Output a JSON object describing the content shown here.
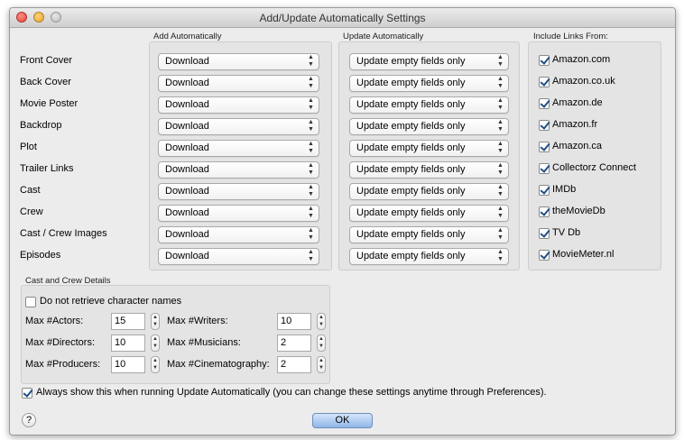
{
  "window": {
    "title": "Add/Update Automatically Settings"
  },
  "columns": {
    "add": "Add Automatically",
    "update": "Update Automatically",
    "links": "Include Links From:"
  },
  "rows": [
    {
      "label": "Front Cover",
      "add": "Download",
      "update": "Update empty fields only"
    },
    {
      "label": "Back Cover",
      "add": "Download",
      "update": "Update empty fields only"
    },
    {
      "label": "Movie Poster",
      "add": "Download",
      "update": "Update empty fields only"
    },
    {
      "label": "Backdrop",
      "add": "Download",
      "update": "Update empty fields only"
    },
    {
      "label": "Plot",
      "add": "Download",
      "update": "Update empty fields only"
    },
    {
      "label": "Trailer Links",
      "add": "Download",
      "update": "Update empty fields only"
    },
    {
      "label": "Cast",
      "add": "Download",
      "update": "Update empty fields only"
    },
    {
      "label": "Crew",
      "add": "Download",
      "update": "Update empty fields only"
    },
    {
      "label": "Cast / Crew Images",
      "add": "Download",
      "update": "Update empty fields only"
    },
    {
      "label": "Episodes",
      "add": "Download",
      "update": "Update empty fields only"
    }
  ],
  "links": [
    {
      "label": "Amazon.com",
      "checked": true
    },
    {
      "label": "Amazon.co.uk",
      "checked": true
    },
    {
      "label": "Amazon.de",
      "checked": true
    },
    {
      "label": "Amazon.fr",
      "checked": true
    },
    {
      "label": "Amazon.ca",
      "checked": true
    },
    {
      "label": "Collectorz Connect",
      "checked": true
    },
    {
      "label": "IMDb",
      "checked": true
    },
    {
      "label": "theMovieDb",
      "checked": true
    },
    {
      "label": "TV Db",
      "checked": true
    },
    {
      "label": "MovieMeter.nl",
      "checked": true
    }
  ],
  "cast_crew": {
    "title": "Cast and Crew Details",
    "no_char_names": {
      "label": "Do not retrieve character names",
      "checked": false
    },
    "fields": {
      "actors": {
        "label": "Max #Actors:",
        "value": "15"
      },
      "directors": {
        "label": "Max #Directors:",
        "value": "10"
      },
      "producers": {
        "label": "Max #Producers:",
        "value": "10"
      },
      "writers": {
        "label": "Max #Writers:",
        "value": "10"
      },
      "musicians": {
        "label": "Max #Musicians:",
        "value": "2"
      },
      "cinematography": {
        "label": "Max #Cinematography:",
        "value": "2"
      }
    }
  },
  "always_show": {
    "label": "Always show this when running Update Automatically (you can change these settings anytime through Preferences).",
    "checked": true
  },
  "buttons": {
    "ok": "OK",
    "help": "?"
  }
}
